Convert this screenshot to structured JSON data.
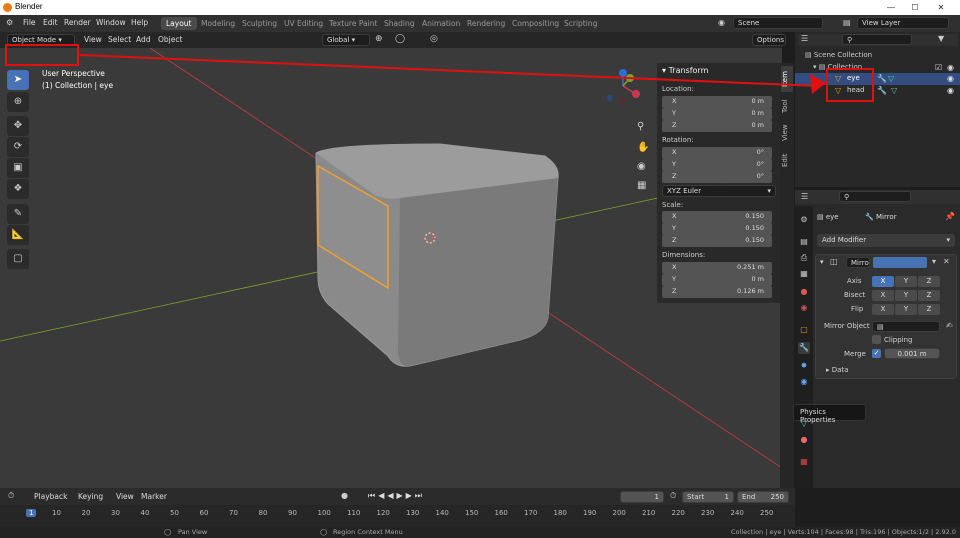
{
  "window": {
    "title": "Blender"
  },
  "menus": [
    "File",
    "Edit",
    "Render",
    "Window",
    "Help"
  ],
  "workspaces": [
    "Layout",
    "Modeling",
    "Sculpting",
    "UV Editing",
    "Texture Paint",
    "Shading",
    "Animation",
    "Rendering",
    "Compositing",
    "Scripting"
  ],
  "scene": {
    "name": "Scene",
    "view_layer": "View Layer"
  },
  "viewport_header": {
    "mode": "Object Mode",
    "menus": [
      "View",
      "Select",
      "Add",
      "Object"
    ],
    "orientation": "Global",
    "options": "Options"
  },
  "viewport": {
    "overlay_line1": "User Perspective",
    "overlay_line2": "(1) Collection | eye"
  },
  "transform_panel": {
    "title": "Transform",
    "location_label": "Location:",
    "location": [
      {
        "axis": "X",
        "value": "0 m"
      },
      {
        "axis": "Y",
        "value": "0 m"
      },
      {
        "axis": "Z",
        "value": "0 m"
      }
    ],
    "rotation_label": "Rotation:",
    "rotation": [
      {
        "axis": "X",
        "value": "0°"
      },
      {
        "axis": "Y",
        "value": "0°"
      },
      {
        "axis": "Z",
        "value": "0°"
      }
    ],
    "rotation_mode": "XYZ Euler",
    "scale_label": "Scale:",
    "scale": [
      {
        "axis": "X",
        "value": "0.150"
      },
      {
        "axis": "Y",
        "value": "0.150"
      },
      {
        "axis": "Z",
        "value": "0.150"
      }
    ],
    "dimensions_label": "Dimensions:",
    "dimensions": [
      {
        "axis": "X",
        "value": "0.251 m"
      },
      {
        "axis": "Y",
        "value": "0 m"
      },
      {
        "axis": "Z",
        "value": "0.126 m"
      }
    ]
  },
  "side_tabs": [
    "Item",
    "Tool",
    "View",
    "Edit"
  ],
  "outliner": {
    "scene_collection": "Scene Collection",
    "collection": "Collection",
    "objects": [
      "eye",
      "head"
    ]
  },
  "properties": {
    "object_name": "eye",
    "modifier_context": "Mirror",
    "add_modifier": "Add Modifier",
    "modifier_name": "Mirro",
    "axis_label": "Axis",
    "bisect_label": "Bisect",
    "flip_label": "Flip",
    "xyz": [
      "X",
      "Y",
      "Z"
    ],
    "mirror_object_label": "Mirror Object",
    "clipping_label": "Clipping",
    "merge_label": "Merge",
    "merge_value": "0.001 m",
    "data_label": "Data",
    "tooltip": "Physics Properties"
  },
  "timeline": {
    "menus": [
      "Playback",
      "Keying",
      "View",
      "Marker"
    ],
    "current_frame": "1",
    "start_label": "Start",
    "start": "1",
    "end_label": "End",
    "end": "250",
    "ticks": [
      "1",
      "10",
      "20",
      "30",
      "40",
      "50",
      "60",
      "70",
      "80",
      "90",
      "100",
      "110",
      "120",
      "130",
      "140",
      "150",
      "160",
      "170",
      "180",
      "190",
      "200",
      "210",
      "220",
      "230",
      "240",
      "250"
    ]
  },
  "statusbar": {
    "pan": "Pan View",
    "context": "Region Context Menu",
    "stats": "Collection | eye | Verts:104 | Faces:98 | Tris:196 | Objects:1/2 | 2.92.0"
  },
  "colors": {
    "accent": "#4772b3",
    "selection": "#f0a030",
    "annotation": "#e01010",
    "x_axis": "#c8384c",
    "y_axis": "#7ba32d"
  }
}
